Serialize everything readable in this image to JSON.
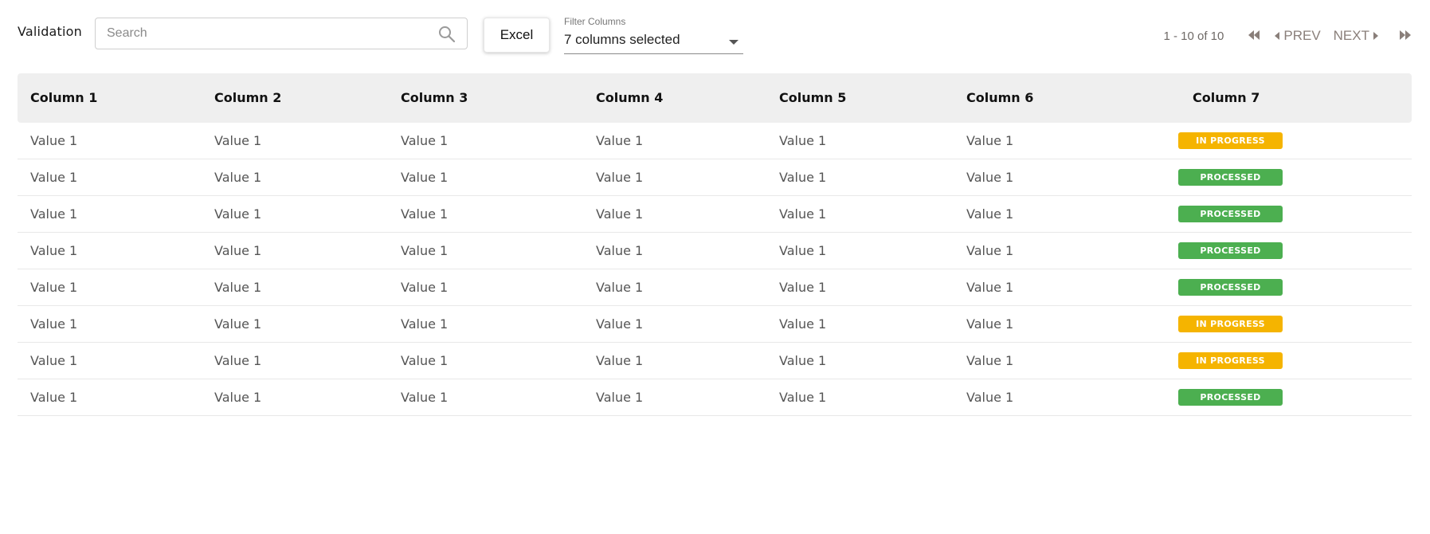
{
  "header": {
    "title": "Validation",
    "search_placeholder": "Search",
    "search_value": "",
    "excel_label": "Excel",
    "filter_label": "Filter Columns",
    "filter_value": "7 columns selected"
  },
  "pagination": {
    "range": "1 - 10 of 10",
    "prev_label": "PREV",
    "next_label": "NEXT"
  },
  "table": {
    "columns": [
      "Column 1",
      "Column 2",
      "Column 3",
      "Column 4",
      "Column 5",
      "Column 6",
      "Column 7"
    ],
    "rows": [
      {
        "c1": "Value 1",
        "c2": "Value 1",
        "c3": "Value 1",
        "c4": "Value 1",
        "c5": "Value 1",
        "c6": "Value 1",
        "status": "IN PROGRESS"
      },
      {
        "c1": "Value 1",
        "c2": "Value 1",
        "c3": "Value 1",
        "c4": "Value 1",
        "c5": "Value 1",
        "c6": "Value 1",
        "status": "PROCESSED"
      },
      {
        "c1": "Value 1",
        "c2": "Value 1",
        "c3": "Value 1",
        "c4": "Value 1",
        "c5": "Value 1",
        "c6": "Value 1",
        "status": "PROCESSED"
      },
      {
        "c1": "Value 1",
        "c2": "Value 1",
        "c3": "Value 1",
        "c4": "Value 1",
        "c5": "Value 1",
        "c6": "Value 1",
        "status": "PROCESSED"
      },
      {
        "c1": "Value 1",
        "c2": "Value 1",
        "c3": "Value 1",
        "c4": "Value 1",
        "c5": "Value 1",
        "c6": "Value 1",
        "status": "PROCESSED"
      },
      {
        "c1": "Value 1",
        "c2": "Value 1",
        "c3": "Value 1",
        "c4": "Value 1",
        "c5": "Value 1",
        "c6": "Value 1",
        "status": "IN PROGRESS"
      },
      {
        "c1": "Value 1",
        "c2": "Value 1",
        "c3": "Value 1",
        "c4": "Value 1",
        "c5": "Value 1",
        "c6": "Value 1",
        "status": "IN PROGRESS"
      },
      {
        "c1": "Value 1",
        "c2": "Value 1",
        "c3": "Value 1",
        "c4": "Value 1",
        "c5": "Value 1",
        "c6": "Value 1",
        "status": "PROCESSED"
      }
    ]
  },
  "colors": {
    "in_progress": "#F5B400",
    "processed": "#4CAF50",
    "header_bg": "#EFEFEF"
  },
  "icons": {
    "search": "search-icon",
    "dropdown": "chevron-down-icon",
    "first_page": "first-page-icon",
    "last_page": "last-page-icon"
  }
}
